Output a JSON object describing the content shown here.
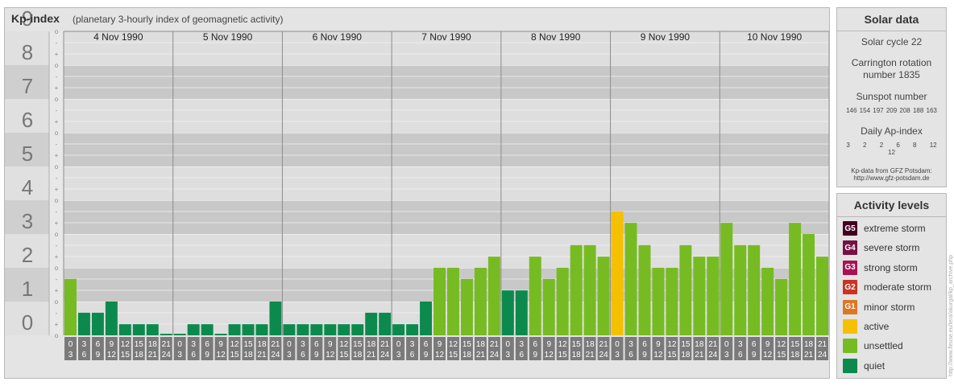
{
  "title": "Kp-index",
  "subtitle": "(planetary 3-hourly index of geomagnetic activity)",
  "chart_data": {
    "type": "bar",
    "ylim": [
      0,
      9
    ],
    "y_major_labels": [
      "0",
      "1",
      "2",
      "3",
      "4",
      "5",
      "6",
      "7",
      "8",
      "9"
    ],
    "minor_marks": [
      "-",
      "o",
      "+"
    ],
    "days": [
      "4 Nov 1990",
      "5 Nov 1990",
      "6 Nov 1990",
      "7 Nov 1990",
      "8 Nov 1990",
      "9 Nov 1990",
      "10 Nov 1990"
    ],
    "interval_starts": [
      "0",
      "3",
      "6",
      "9",
      "12",
      "15",
      "18",
      "21"
    ],
    "interval_ends": [
      "3",
      "6",
      "9",
      "12",
      "15",
      "18",
      "21",
      "24"
    ],
    "values": [
      1.67,
      0.67,
      0.67,
      1.0,
      0.33,
      0.33,
      0.33,
      0.0,
      0.0,
      0.33,
      0.33,
      0.0,
      0.33,
      0.33,
      0.33,
      1.0,
      0.33,
      0.33,
      0.33,
      0.33,
      0.33,
      0.33,
      0.67,
      0.67,
      0.33,
      0.33,
      1.0,
      2.0,
      2.0,
      1.67,
      2.0,
      2.33,
      1.33,
      1.33,
      2.33,
      1.67,
      2.0,
      2.67,
      2.67,
      2.33,
      3.67,
      3.33,
      2.67,
      2.0,
      2.0,
      2.67,
      2.33,
      2.33,
      3.33,
      2.67,
      2.67,
      2.0,
      1.67,
      3.33,
      3.0,
      2.33
    ],
    "colors": {
      "quiet": "#0c8a4e",
      "unsettled": "#77bb22",
      "active": "#f5c000",
      "minor": "#dd7722",
      "moderate": "#cc3322",
      "strong": "#aa1155",
      "severe": "#771144",
      "extreme": "#440022"
    }
  },
  "solar": {
    "title": "Solar data",
    "cycle": "Solar cycle 22",
    "carrington": "Carrington rotation number 1835",
    "sunspot_title": "Sunspot number",
    "sunspot_values": "146 154 197 209 208 188 163",
    "ap_title": "Daily Ap-index",
    "ap_values": "3 2 2 6 8 12 12",
    "source_line1": "Kp-data from GFZ Potsdam:",
    "source_line2": "http://www.gfz-potsdam.de"
  },
  "activity": {
    "title": "Activity levels",
    "items": [
      {
        "code": "G5",
        "label": "extreme storm",
        "color": "#440022"
      },
      {
        "code": "G4",
        "label": "severe storm",
        "color": "#771144"
      },
      {
        "code": "G3",
        "label": "strong storm",
        "color": "#aa1155"
      },
      {
        "code": "G2",
        "label": "moderate storm",
        "color": "#cc3322"
      },
      {
        "code": "G1",
        "label": "minor storm",
        "color": "#dd7722"
      },
      {
        "code": "",
        "label": "active",
        "color": "#f5c000"
      },
      {
        "code": "",
        "label": "unsettled",
        "color": "#77bb22"
      },
      {
        "code": "",
        "label": "quiet",
        "color": "#0c8a4e"
      }
    ]
  },
  "credit": "http://www.fleuse.eu/tera/akurgal/kp_archive.php"
}
